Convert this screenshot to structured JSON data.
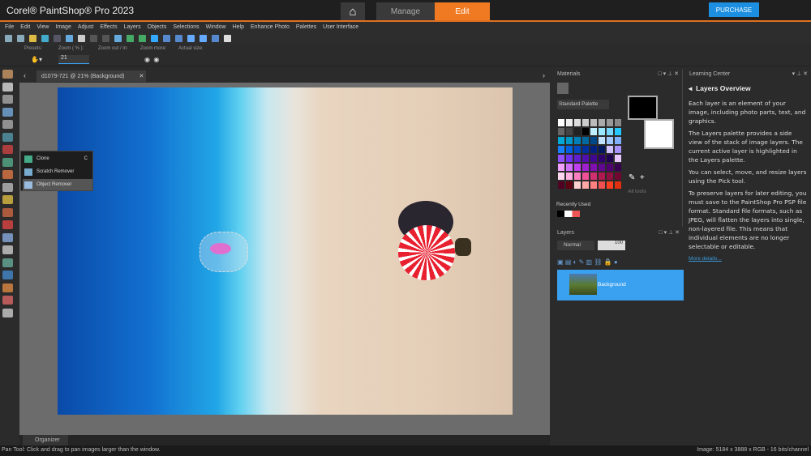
{
  "titlebar": {
    "brand": "Corel® PaintShop® Pro 2023",
    "tabs": {
      "manage": "Manage",
      "edit": "Edit"
    },
    "purchase": "PURCHASE"
  },
  "menu": [
    "File",
    "Edit",
    "View",
    "Image",
    "Adjust",
    "Effects",
    "Layers",
    "Objects",
    "Selections",
    "Window",
    "Help",
    "Enhance Photo",
    "Palettes",
    "User Interface"
  ],
  "options": {
    "presets": "Presets:",
    "zoom_label": "Zoom ( % ):",
    "zoom_value": "21",
    "zoom_out_in": "Zoom out / in:",
    "zoom_more": "Zoom more:",
    "actual_size": "Actual size:"
  },
  "document": {
    "tab": "d1079-721 @  21% (Background)"
  },
  "flyout": {
    "items": [
      {
        "label": "Clone",
        "shortcut": "C"
      },
      {
        "label": "Scratch Remover"
      },
      {
        "label": "Object Remover"
      }
    ]
  },
  "materials": {
    "title": "Materials",
    "palette_select": "Standard Palette",
    "all_tools": "All tools",
    "recently_used": "Recently Used",
    "swatches": [
      "#ffffff",
      "#eeeeee",
      "#dddddd",
      "#cccccc",
      "#bbbbbb",
      "#aaaaaa",
      "#999999",
      "#888888",
      "#666666",
      "#444444",
      "#222222",
      "#000000",
      "#bff0ff",
      "#99e6ff",
      "#77d8ff",
      "#22c8ff",
      "#00a8d8",
      "#0098c8",
      "#0080b8",
      "#006aa0",
      "#004888",
      "#c0e0ff",
      "#a0c8ff",
      "#80b0ff",
      "#1880ff",
      "#0060e0",
      "#0048c0",
      "#0030a0",
      "#002080",
      "#001860",
      "#d0c0ff",
      "#a890ff",
      "#9050ff",
      "#7030f0",
      "#6020d0",
      "#5010b0",
      "#400890",
      "#300070",
      "#200050",
      "#e8c8ff",
      "#f0a0ff",
      "#d070ff",
      "#c040f0",
      "#a020d0",
      "#8010b0",
      "#600890",
      "#500070",
      "#380050",
      "#ffd8f0",
      "#ffb0e0",
      "#ff80c0",
      "#f05098",
      "#d03070",
      "#b01850",
      "#901040",
      "#700830",
      "#500020",
      "#600010",
      "#ffd0d0",
      "#ffa8a8",
      "#ff8080",
      "#f05050",
      "#ff4020",
      "#e03010",
      "#c02000",
      "#800000",
      "#600000",
      "#ffe0d0",
      "#ffc0a0",
      "#ffa070",
      "#ff8040",
      "#ff6010",
      "#f04000",
      "#d03000"
    ]
  },
  "layers": {
    "title": "Layers",
    "blend": "Normal",
    "opacity": "100",
    "layer_name": "Background"
  },
  "learning": {
    "title": "Learning Center",
    "heading": "Layers Overview",
    "paragraphs": [
      "Each layer is an element of your image, including photo parts, text, and graphics.",
      "The Layers palette provides a side view of the stack of image layers. The current active layer is highlighted in the Layers palette.",
      "You can select, move, and resize layers using the Pick tool.",
      "To preserve layers for later editing, you must save to the PaintShop Pro PSP file format. Standard file formats, such as JPEG, will flatten the layers into single, non-layered file. This means that individual elements are no longer selectable or editable."
    ],
    "link": "More details..."
  },
  "organizer": "Organizer",
  "status": {
    "left": "Pan Tool: Click and drag to pan images larger than the window.",
    "right": "Image:  5184 x 3888 x RGB - 16 bits/channel"
  }
}
